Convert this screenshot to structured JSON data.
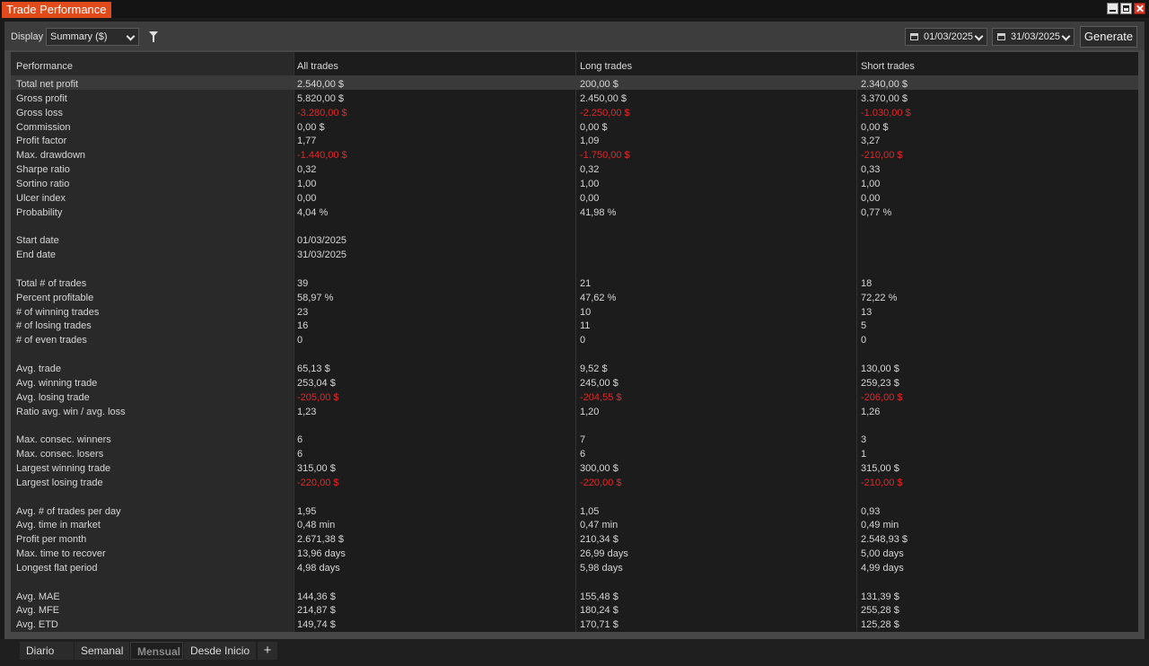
{
  "window": {
    "title": "Trade Performance"
  },
  "toolbar": {
    "display_label": "Display",
    "display_value": "Summary ($)",
    "date_from": "01/03/2025",
    "date_to": "31/03/2025",
    "generate_label": "Generate"
  },
  "table": {
    "headers": [
      "Performance",
      "All trades",
      "Long trades",
      "Short trades"
    ],
    "rows": [
      {
        "label": "Total net profit",
        "all": "2.540,00 $",
        "long": "200,00 $",
        "short": "2.340,00 $"
      },
      {
        "label": "Gross profit",
        "all": "5.820,00 $",
        "long": "2.450,00 $",
        "short": "3.370,00 $"
      },
      {
        "label": "Gross loss",
        "all": "-3.280,00 $",
        "long": "-2.250,00 $",
        "short": "-1.030,00 $",
        "neg": true
      },
      {
        "label": "Commission",
        "all": "0,00 $",
        "long": "0,00 $",
        "short": "0,00 $"
      },
      {
        "label": "Profit factor",
        "all": "1,77",
        "long": "1,09",
        "short": "3,27"
      },
      {
        "label": "Max. drawdown",
        "all": "-1.440,00 $",
        "long": "-1.750,00 $",
        "short": "-210,00 $",
        "neg": true
      },
      {
        "label": "Sharpe ratio",
        "all": "0,32",
        "long": "0,32",
        "short": "0,33"
      },
      {
        "label": "Sortino ratio",
        "all": "1,00",
        "long": "1,00",
        "short": "1,00"
      },
      {
        "label": "Ulcer index",
        "all": "0,00",
        "long": "0,00",
        "short": "0,00"
      },
      {
        "label": "Probability",
        "all": "4,04 %",
        "long": "41,98 %",
        "short": "0,77 %"
      },
      {
        "label": "",
        "all": "",
        "long": "",
        "short": ""
      },
      {
        "label": "Start date",
        "all": "01/03/2025",
        "long": "",
        "short": ""
      },
      {
        "label": "End date",
        "all": "31/03/2025",
        "long": "",
        "short": ""
      },
      {
        "label": "",
        "all": "",
        "long": "",
        "short": ""
      },
      {
        "label": "Total # of trades",
        "all": "39",
        "long": "21",
        "short": "18"
      },
      {
        "label": "Percent profitable",
        "all": "58,97 %",
        "long": "47,62 %",
        "short": "72,22 %"
      },
      {
        "label": "# of winning trades",
        "all": "23",
        "long": "10",
        "short": "13"
      },
      {
        "label": "# of losing trades",
        "all": "16",
        "long": "11",
        "short": "5"
      },
      {
        "label": "# of even trades",
        "all": "0",
        "long": "0",
        "short": "0"
      },
      {
        "label": "",
        "all": "",
        "long": "",
        "short": ""
      },
      {
        "label": "Avg. trade",
        "all": "65,13 $",
        "long": "9,52 $",
        "short": "130,00 $"
      },
      {
        "label": "Avg. winning trade",
        "all": "253,04 $",
        "long": "245,00 $",
        "short": "259,23 $"
      },
      {
        "label": "Avg. losing trade",
        "all": "-205,00 $",
        "long": "-204,55 $",
        "short": "-206,00 $",
        "neg": true
      },
      {
        "label": "Ratio avg. win / avg. loss",
        "all": "1,23",
        "long": "1,20",
        "short": "1,26"
      },
      {
        "label": "",
        "all": "",
        "long": "",
        "short": ""
      },
      {
        "label": "Max. consec. winners",
        "all": "6",
        "long": "7",
        "short": "3"
      },
      {
        "label": "Max. consec. losers",
        "all": "6",
        "long": "6",
        "short": "1"
      },
      {
        "label": "Largest winning trade",
        "all": "315,00 $",
        "long": "300,00 $",
        "short": "315,00 $"
      },
      {
        "label": "Largest losing trade",
        "all": "-220,00 $",
        "long": "-220,00 $",
        "short": "-210,00 $",
        "neg": true
      },
      {
        "label": "",
        "all": "",
        "long": "",
        "short": ""
      },
      {
        "label": "Avg. # of trades per day",
        "all": "1,95",
        "long": "1,05",
        "short": "0,93"
      },
      {
        "label": "Avg. time in market",
        "all": "0,48 min",
        "long": "0,47 min",
        "short": "0,49 min"
      },
      {
        "label": "Profit per month",
        "all": "2.671,38 $",
        "long": "210,34 $",
        "short": "2.548,93 $"
      },
      {
        "label": "Max. time to recover",
        "all": "13,96 days",
        "long": "26,99 days",
        "short": "5,00 days"
      },
      {
        "label": "Longest flat period",
        "all": "4,98 days",
        "long": "5,98 days",
        "short": "4,99 days"
      },
      {
        "label": "",
        "all": "",
        "long": "",
        "short": ""
      },
      {
        "label": "Avg. MAE",
        "all": "144,36 $",
        "long": "155,48 $",
        "short": "131,39 $"
      },
      {
        "label": "Avg. MFE",
        "all": "214,87 $",
        "long": "180,24 $",
        "short": "255,28 $"
      },
      {
        "label": "Avg. ETD",
        "all": "149,74 $",
        "long": "170,71 $",
        "short": "125,28 $"
      }
    ]
  },
  "tabs": [
    {
      "label": "Diario",
      "active": false
    },
    {
      "label": "Semanal",
      "active": false
    },
    {
      "label": "Mensual",
      "active": true
    },
    {
      "label": "Desde Inicio",
      "active": false
    }
  ],
  "tab_add_label": "+",
  "colors": {
    "accent": "#e14a1a",
    "negative": "#e0282a",
    "background": "#1c1c1c"
  }
}
